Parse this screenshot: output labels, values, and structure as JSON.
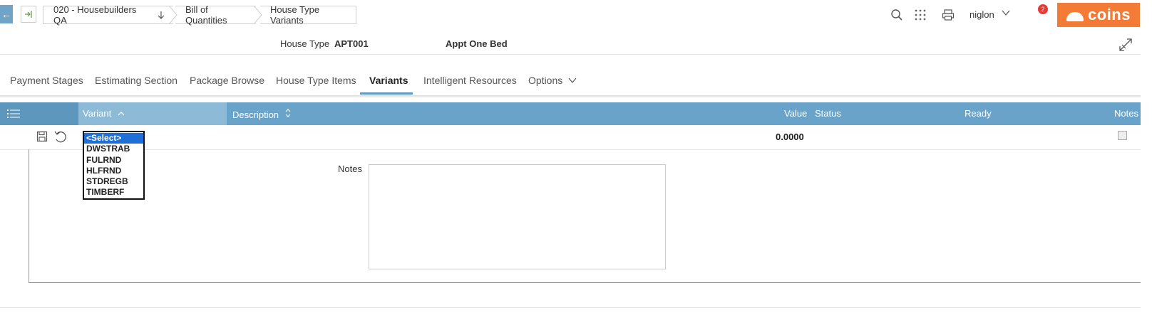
{
  "nav": {
    "back_icon": "arrow-left-icon",
    "home_icon": "enter-icon",
    "breadcrumbs": [
      {
        "label": "020 - Housebuilders QA"
      },
      {
        "label": "Bill of Quantities"
      },
      {
        "label": "House Type Variants"
      }
    ]
  },
  "toolbar": {
    "user_name": "niglon",
    "notification_count": "2",
    "logo_text": "coins"
  },
  "header": {
    "house_type_label": "House Type",
    "house_type_code": "APT001",
    "house_type_desc": "Appt One Bed"
  },
  "tabs": [
    {
      "label": "Payment Stages"
    },
    {
      "label": "Estimating Section"
    },
    {
      "label": "Package Browse"
    },
    {
      "label": "House Type Items"
    },
    {
      "label": "Variants"
    },
    {
      "label": "Intelligent Resources"
    },
    {
      "label": "Options"
    }
  ],
  "active_tab": "Variants",
  "grid": {
    "columns": [
      {
        "label": "Variant"
      },
      {
        "label": "Description"
      },
      {
        "label": "Value"
      },
      {
        "label": "Status"
      },
      {
        "label": "Ready"
      },
      {
        "label": "Notes"
      }
    ],
    "row": {
      "value": "0.0000",
      "notes_checked": false
    },
    "variant_options": [
      "<Select>",
      "DWSTRAB",
      "FULRND",
      "HLFRND",
      "STDREGB",
      "TIMBERF"
    ],
    "variant_selected": "<Select>"
  },
  "detail": {
    "notes_label": "Notes",
    "notes_value": ""
  },
  "colors": {
    "grid_header": "#6aa3c9",
    "accent": "#5b9ac4",
    "logo": "#f47b35",
    "selection": "#1e6fd8"
  }
}
